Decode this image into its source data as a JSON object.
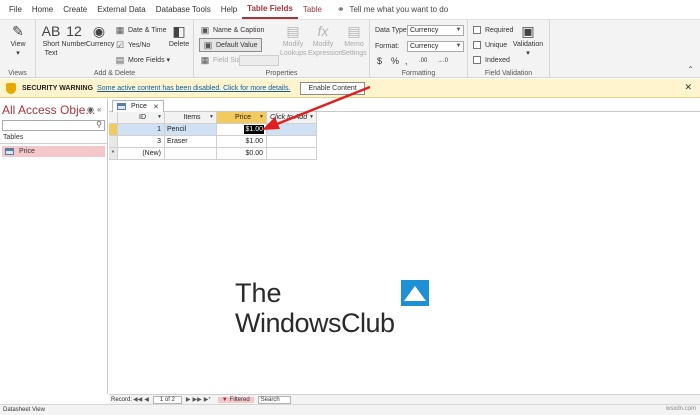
{
  "menu": {
    "items": [
      {
        "label": "File"
      },
      {
        "label": "Home"
      },
      {
        "label": "Create"
      },
      {
        "label": "External Data"
      },
      {
        "label": "Database Tools"
      },
      {
        "label": "Help"
      },
      {
        "label": "Table Fields"
      },
      {
        "label": "Table"
      }
    ],
    "tell_me": "Tell me what you want to do"
  },
  "ribbon": {
    "views": {
      "view_label": "View",
      "group": "Views"
    },
    "add_delete": {
      "short_text": "Short Text",
      "number": "Number",
      "currency": "Currency",
      "date_time": "Date & Time",
      "yes_no": "Yes/No",
      "more_fields": "More Fields",
      "delete": "Delete",
      "group": "Add & Delete"
    },
    "properties": {
      "name_caption": "Name & Caption",
      "default_value": "Default Value",
      "field_size": "Field Size",
      "modify_lookups": "Modify Lookups",
      "modify_expression": "Modify Expression",
      "memo_settings": "Memo Settings",
      "group": "Properties"
    },
    "formatting": {
      "data_type_label": "Data Type:",
      "data_type_value": "Currency",
      "format_label": "Format:",
      "format_value": "Currency",
      "dollar": "$",
      "percent": "%",
      "comma": ",",
      "inc_dec": ".00",
      "dec_dec": "→.0",
      "group": "Formatting"
    },
    "validation": {
      "required": "Required",
      "unique": "Unique",
      "indexed": "Indexed",
      "validation_btn": "Validation",
      "group": "Field Validation"
    }
  },
  "security": {
    "title": "SECURITY WARNING",
    "message": "Some active content has been disabled. Click for more details.",
    "button": "Enable Content"
  },
  "nav": {
    "title": "All Access Obje...",
    "section": "Tables",
    "items": [
      {
        "label": "Price"
      }
    ]
  },
  "document": {
    "tab_label": "Price"
  },
  "table": {
    "headers": [
      "ID",
      "Items",
      "Price",
      "Click to Add"
    ],
    "rows": [
      {
        "id": "1",
        "items": "Pencil",
        "price": "$1.00"
      },
      {
        "id": "3",
        "items": "Eraser",
        "price": "$1.00"
      }
    ],
    "new_row": {
      "id": "(New)",
      "price": "$0.00"
    }
  },
  "record_nav": {
    "label": "Record:",
    "position": "1 of 2",
    "filter": "Filtered",
    "search": "Search"
  },
  "status": {
    "left": "Datasheet View",
    "right": "wsxdn.com"
  },
  "watermark": {
    "line1": "The",
    "line2": "WindowsClub"
  },
  "colors": {
    "accent": "#a4373a",
    "security_bar": "#fff4ce",
    "selected_header": "#f4c95d",
    "current_row": "#cfe1f3",
    "arrow": "#e02020"
  }
}
